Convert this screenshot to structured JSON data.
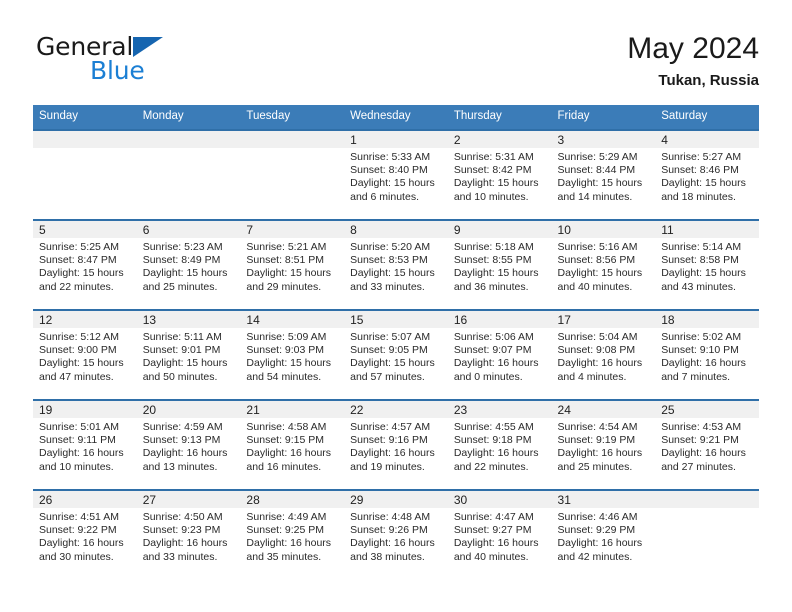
{
  "brand": {
    "name_top": "General",
    "name_bottom": "Blue",
    "triangle_color": "#1665b0",
    "blue_text_color": "#1b7fd4"
  },
  "header": {
    "title": "May 2024",
    "subtitle": "Tukan, Russia"
  },
  "theme": {
    "header_bg": "#3b7cb8",
    "row_divider": "#2f6fa8",
    "daynum_bg": "#f0f0f0"
  },
  "calendar": {
    "weekday_headers": [
      "Sunday",
      "Monday",
      "Tuesday",
      "Wednesday",
      "Thursday",
      "Friday",
      "Saturday"
    ],
    "labels": {
      "sunrise": "Sunrise:",
      "sunset": "Sunset:",
      "daylight": "Daylight:"
    },
    "weeks": [
      [
        {
          "day": "",
          "empty": true
        },
        {
          "day": "",
          "empty": true
        },
        {
          "day": "",
          "empty": true
        },
        {
          "day": "1",
          "sunrise": "Sunrise: 5:33 AM",
          "sunset": "Sunset: 8:40 PM",
          "daylight": "Daylight: 15 hours and 6 minutes."
        },
        {
          "day": "2",
          "sunrise": "Sunrise: 5:31 AM",
          "sunset": "Sunset: 8:42 PM",
          "daylight": "Daylight: 15 hours and 10 minutes."
        },
        {
          "day": "3",
          "sunrise": "Sunrise: 5:29 AM",
          "sunset": "Sunset: 8:44 PM",
          "daylight": "Daylight: 15 hours and 14 minutes."
        },
        {
          "day": "4",
          "sunrise": "Sunrise: 5:27 AM",
          "sunset": "Sunset: 8:46 PM",
          "daylight": "Daylight: 15 hours and 18 minutes."
        }
      ],
      [
        {
          "day": "5",
          "sunrise": "Sunrise: 5:25 AM",
          "sunset": "Sunset: 8:47 PM",
          "daylight": "Daylight: 15 hours and 22 minutes."
        },
        {
          "day": "6",
          "sunrise": "Sunrise: 5:23 AM",
          "sunset": "Sunset: 8:49 PM",
          "daylight": "Daylight: 15 hours and 25 minutes."
        },
        {
          "day": "7",
          "sunrise": "Sunrise: 5:21 AM",
          "sunset": "Sunset: 8:51 PM",
          "daylight": "Daylight: 15 hours and 29 minutes."
        },
        {
          "day": "8",
          "sunrise": "Sunrise: 5:20 AM",
          "sunset": "Sunset: 8:53 PM",
          "daylight": "Daylight: 15 hours and 33 minutes."
        },
        {
          "day": "9",
          "sunrise": "Sunrise: 5:18 AM",
          "sunset": "Sunset: 8:55 PM",
          "daylight": "Daylight: 15 hours and 36 minutes."
        },
        {
          "day": "10",
          "sunrise": "Sunrise: 5:16 AM",
          "sunset": "Sunset: 8:56 PM",
          "daylight": "Daylight: 15 hours and 40 minutes."
        },
        {
          "day": "11",
          "sunrise": "Sunrise: 5:14 AM",
          "sunset": "Sunset: 8:58 PM",
          "daylight": "Daylight: 15 hours and 43 minutes."
        }
      ],
      [
        {
          "day": "12",
          "sunrise": "Sunrise: 5:12 AM",
          "sunset": "Sunset: 9:00 PM",
          "daylight": "Daylight: 15 hours and 47 minutes."
        },
        {
          "day": "13",
          "sunrise": "Sunrise: 5:11 AM",
          "sunset": "Sunset: 9:01 PM",
          "daylight": "Daylight: 15 hours and 50 minutes."
        },
        {
          "day": "14",
          "sunrise": "Sunrise: 5:09 AM",
          "sunset": "Sunset: 9:03 PM",
          "daylight": "Daylight: 15 hours and 54 minutes."
        },
        {
          "day": "15",
          "sunrise": "Sunrise: 5:07 AM",
          "sunset": "Sunset: 9:05 PM",
          "daylight": "Daylight: 15 hours and 57 minutes."
        },
        {
          "day": "16",
          "sunrise": "Sunrise: 5:06 AM",
          "sunset": "Sunset: 9:07 PM",
          "daylight": "Daylight: 16 hours and 0 minutes."
        },
        {
          "day": "17",
          "sunrise": "Sunrise: 5:04 AM",
          "sunset": "Sunset: 9:08 PM",
          "daylight": "Daylight: 16 hours and 4 minutes."
        },
        {
          "day": "18",
          "sunrise": "Sunrise: 5:02 AM",
          "sunset": "Sunset: 9:10 PM",
          "daylight": "Daylight: 16 hours and 7 minutes."
        }
      ],
      [
        {
          "day": "19",
          "sunrise": "Sunrise: 5:01 AM",
          "sunset": "Sunset: 9:11 PM",
          "daylight": "Daylight: 16 hours and 10 minutes."
        },
        {
          "day": "20",
          "sunrise": "Sunrise: 4:59 AM",
          "sunset": "Sunset: 9:13 PM",
          "daylight": "Daylight: 16 hours and 13 minutes."
        },
        {
          "day": "21",
          "sunrise": "Sunrise: 4:58 AM",
          "sunset": "Sunset: 9:15 PM",
          "daylight": "Daylight: 16 hours and 16 minutes."
        },
        {
          "day": "22",
          "sunrise": "Sunrise: 4:57 AM",
          "sunset": "Sunset: 9:16 PM",
          "daylight": "Daylight: 16 hours and 19 minutes."
        },
        {
          "day": "23",
          "sunrise": "Sunrise: 4:55 AM",
          "sunset": "Sunset: 9:18 PM",
          "daylight": "Daylight: 16 hours and 22 minutes."
        },
        {
          "day": "24",
          "sunrise": "Sunrise: 4:54 AM",
          "sunset": "Sunset: 9:19 PM",
          "daylight": "Daylight: 16 hours and 25 minutes."
        },
        {
          "day": "25",
          "sunrise": "Sunrise: 4:53 AM",
          "sunset": "Sunset: 9:21 PM",
          "daylight": "Daylight: 16 hours and 27 minutes."
        }
      ],
      [
        {
          "day": "26",
          "sunrise": "Sunrise: 4:51 AM",
          "sunset": "Sunset: 9:22 PM",
          "daylight": "Daylight: 16 hours and 30 minutes."
        },
        {
          "day": "27",
          "sunrise": "Sunrise: 4:50 AM",
          "sunset": "Sunset: 9:23 PM",
          "daylight": "Daylight: 16 hours and 33 minutes."
        },
        {
          "day": "28",
          "sunrise": "Sunrise: 4:49 AM",
          "sunset": "Sunset: 9:25 PM",
          "daylight": "Daylight: 16 hours and 35 minutes."
        },
        {
          "day": "29",
          "sunrise": "Sunrise: 4:48 AM",
          "sunset": "Sunset: 9:26 PM",
          "daylight": "Daylight: 16 hours and 38 minutes."
        },
        {
          "day": "30",
          "sunrise": "Sunrise: 4:47 AM",
          "sunset": "Sunset: 9:27 PM",
          "daylight": "Daylight: 16 hours and 40 minutes."
        },
        {
          "day": "31",
          "sunrise": "Sunrise: 4:46 AM",
          "sunset": "Sunset: 9:29 PM",
          "daylight": "Daylight: 16 hours and 42 minutes."
        },
        {
          "day": "",
          "empty": true
        }
      ]
    ]
  }
}
